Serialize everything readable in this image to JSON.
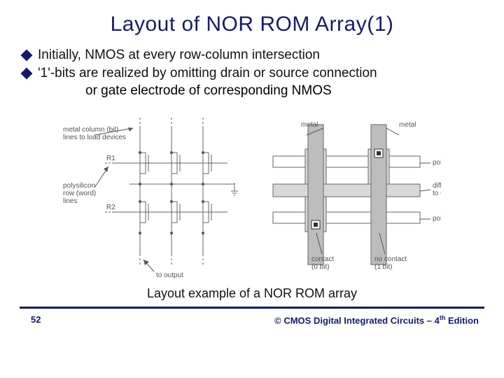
{
  "title": "Layout of NOR ROM Array(1)",
  "bullets": [
    "Initially, NMOS at every row-column intersection",
    "'1'-bits are realized by omitting drain or source connection"
  ],
  "bullet_continuation": "or gate electrode of corresponding NMOS",
  "figure": {
    "labels": {
      "col_lines": "metal column (bit)\nlines to load devices",
      "poly_row": "polysilicon\nrow (word)\nlines",
      "r1": "R1",
      "r2": "R2",
      "to_output": "to output",
      "metal1": "metal",
      "metal2": "metal",
      "poly1": "poly",
      "poly2": "poly",
      "diffusion": "diffusion\nto GND",
      "contact0": "contact\n(0 bit)",
      "no_contact": "no contact\n(1 bit)"
    }
  },
  "caption": "Layout example of a NOR ROM array",
  "footer": {
    "page": "52",
    "credit_prefix": "© CMOS Digital Integrated Circuits – 4",
    "credit_sup": "th",
    "credit_suffix": " Edition"
  }
}
